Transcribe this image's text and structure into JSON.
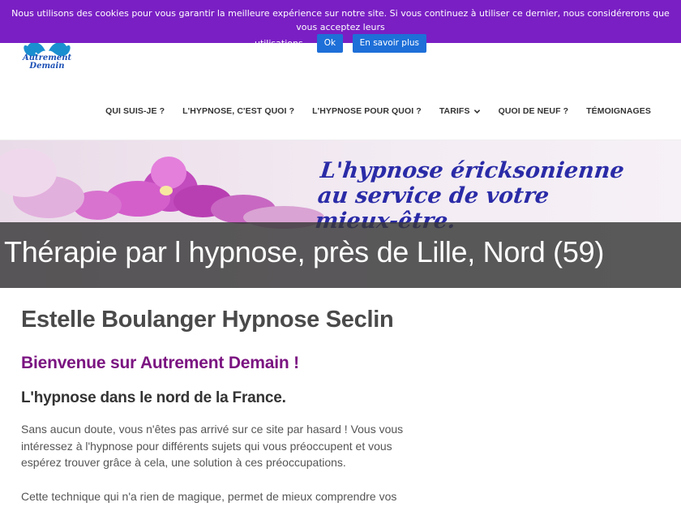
{
  "cookie": {
    "message_line1": "Nous utilisons des cookies pour vous garantir la meilleure expérience sur notre site. Si vous continuez à utiliser ce dernier, nous considérerons que vous acceptez leurs",
    "message_line2": "utilisations.",
    "ok_label": "Ok",
    "more_label": "En savoir plus"
  },
  "logo": {
    "line1": "Autrement",
    "line2": "Demain"
  },
  "nav": {
    "items": [
      {
        "label": "QUI SUIS-JE ?"
      },
      {
        "label": "L'HYPNOSE, C'EST QUOI ?"
      },
      {
        "label": "L'HYPNOSE POUR QUOI ?"
      },
      {
        "label": "TARIFS",
        "icon": "chevron-down-icon"
      },
      {
        "label": "QUOI DE NEUF ?"
      },
      {
        "label": "TÉMOIGNAGES"
      }
    ]
  },
  "banner": {
    "script_line1": "L'hypnose éricksonienne",
    "script_line2": "au service de votre",
    "script_line3": "mieux-être.",
    "caption": "Thérapie par l hypnose, près de Lille, Nord (59)"
  },
  "content": {
    "title": "Estelle Boulanger Hypnose Seclin",
    "welcome": "Bienvenue sur Autrement Demain !",
    "subtitle": "L'hypnose dans le nord de la France.",
    "paragraph1": "Sans aucun doute, vous n'êtes pas arrivé sur ce site par hasard ! Vous vous intéressez à l'hypnose pour différents sujets qui vous préoccupent et vous espérez trouver grâce à cela, une solution à ces préoccupations.",
    "paragraph2": "Cette technique qui n'a rien de magique, permet de mieux comprendre vos"
  },
  "colors": {
    "cookie_bar": "#7a1fc4",
    "button_blue": "#1e6fd8",
    "welcome_purple": "#7b1481",
    "script_blue": "#2a2ba7"
  }
}
